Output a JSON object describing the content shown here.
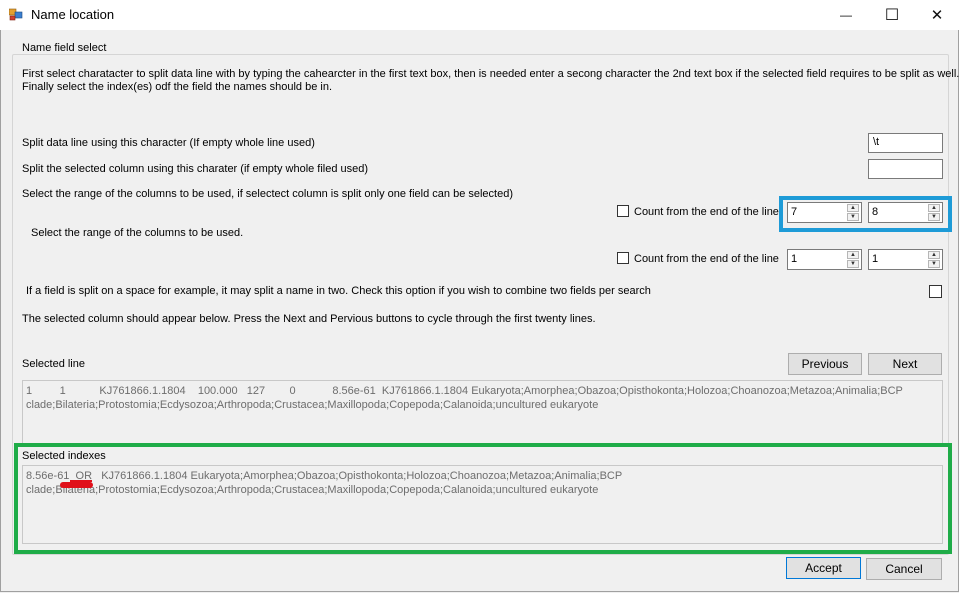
{
  "window": {
    "title": "Name location",
    "minimize_glyph": "—",
    "maximize_glyph": "☐",
    "close_glyph": "✕"
  },
  "group": {
    "legend": "Name field select",
    "instructions_line1": "First select charatacter to split data line with by typing the cahearcter in the first text box, then is needed enter a secong character the 2nd text box if the selected field requires to be split as well.",
    "instructions_line2": "Finally select the index(es) odf the field the names should be in."
  },
  "split_line": {
    "label": "Split data line using this character (If empty whole line used)",
    "value": "\\t"
  },
  "split_column": {
    "label": "Split the selected column using this charater (if empty whole filed used)",
    "value": ""
  },
  "range_primary": {
    "label": "Select the range of the columns to be used, if selectect column is split only one field can be selected)",
    "checkbox_label": "Count from the end of the line",
    "checked": false,
    "from": "7",
    "to": "8"
  },
  "range_secondary": {
    "label": "Select the range of the columns to be used.",
    "checkbox_label": "Count from the end of the line",
    "checked": false,
    "from": "1",
    "to": "1"
  },
  "combine": {
    "label": "If a field is split on a space for example, it may split a name in two. Check this option if you wish to combine two fields per search",
    "checked": false
  },
  "cycle_hint": "The selected column should appear below. Press the Next and Pervious buttons to cycle through the first twenty lines.",
  "selected_line": {
    "label": "Selected line",
    "text_line1": "1         1           KJ761866.1.1804    100.000   127        0            8.56e-61  KJ761866.1.1804 Eukaryota;Amorphea;Obazoa;Opisthokonta;Holozoa;Choanozoa;Metazoa;Animalia;BCP",
    "text_line2": "clade;Bilateria;Protostomia;Ecdysozoa;Arthropoda;Crustacea;Maxillopoda;Copepoda;Calanoida;uncultured eukaryote"
  },
  "nav": {
    "previous": "Previous",
    "next": "Next"
  },
  "selected_indexes": {
    "label": "Selected indexes",
    "text_line1": "8.56e-61  OR   KJ761866.1.1804 Eukaryota;Amorphea;Obazoa;Opisthokonta;Holozoa;Choanozoa;Metazoa;Animalia;BCP",
    "text_line2": "clade;Bilateria;Protostomia;Ecdysozoa;Arthropoda;Crustacea;Maxillopoda;Copepoda;Calanoida;uncultured eukaryote"
  },
  "actions": {
    "accept": "Accept",
    "cancel": "Cancel"
  },
  "colors": {
    "highlight_blue": "#1e9bd7",
    "highlight_green": "#1fac48",
    "annotation_red": "#e0101a"
  }
}
